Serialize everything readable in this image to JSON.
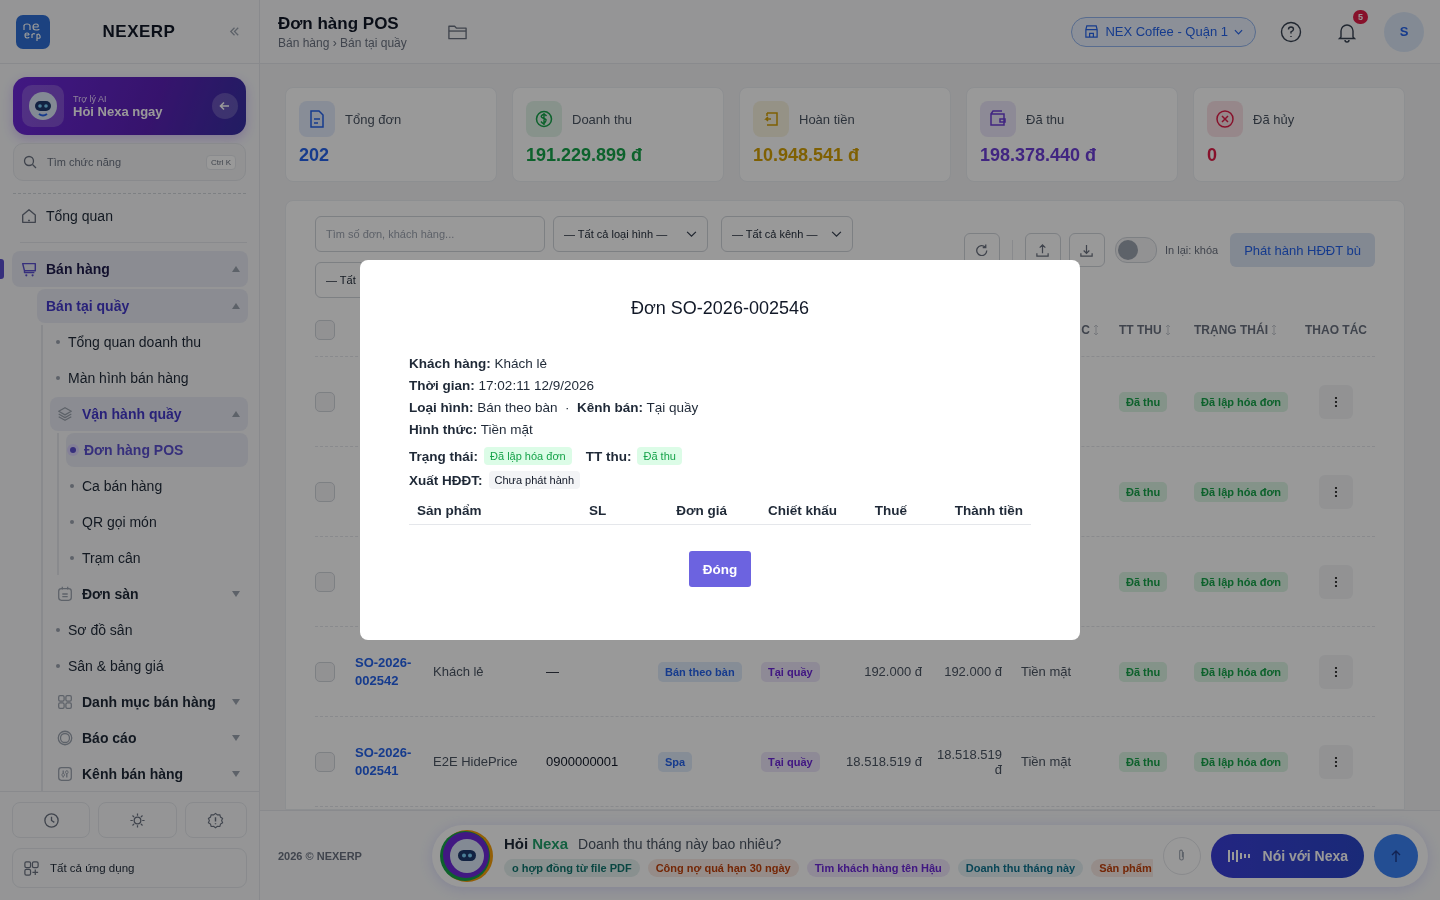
{
  "sidebar": {
    "brand": "NEXERP",
    "ai_card": {
      "caption": "Trợ lý AI",
      "title": "Hỏi Nexa ngay"
    },
    "search": {
      "placeholder": "Tìm chức năng",
      "shortcut": "Ctrl K"
    },
    "nav": [
      {
        "label": "Tổng quan",
        "kind": "link",
        "selected": false
      },
      {
        "label": "Bán hàng",
        "kind": "group",
        "expanded": true,
        "selected": true,
        "children": [
          {
            "label": "Bán tại quầy",
            "kind": "group",
            "expanded": true,
            "selected": true,
            "children": [
              {
                "label": "Tổng quan doanh thu",
                "kind": "link",
                "selected": false
              },
              {
                "label": "Màn hình bán hàng",
                "kind": "link",
                "selected": false
              },
              {
                "label": "Vận hành quầy",
                "kind": "group",
                "expanded": true,
                "selected": true,
                "children": [
                  {
                    "label": "Đơn hàng POS",
                    "kind": "link",
                    "selected": true
                  },
                  {
                    "label": "Ca bán hàng",
                    "kind": "link",
                    "selected": false
                  },
                  {
                    "label": "QR gọi món",
                    "kind": "link",
                    "selected": false
                  },
                  {
                    "label": "Trạm cân",
                    "kind": "link",
                    "selected": false
                  }
                ]
              },
              {
                "label": "Đơn sàn",
                "kind": "group",
                "expanded": false,
                "selected": false
              },
              {
                "label": "Sơ đồ sân",
                "kind": "link",
                "selected": false
              },
              {
                "label": "Sân & bảng giá",
                "kind": "link",
                "selected": false
              },
              {
                "label": "Danh mục bán hàng",
                "kind": "group",
                "expanded": false,
                "selected": false
              },
              {
                "label": "Báo cáo",
                "kind": "group",
                "expanded": false,
                "selected": false
              },
              {
                "label": "Kênh bán hàng",
                "kind": "group",
                "expanded": false,
                "selected": false
              }
            ]
          }
        ]
      }
    ],
    "all_apps": "Tất cả ứng dụng"
  },
  "header": {
    "title": "Đơn hàng POS",
    "breadcrumb": "Bán hàng › Bán tại quầy",
    "store": "NEX Coffee - Quận 1",
    "notifications": "5",
    "avatar": "S"
  },
  "stats": [
    {
      "label": "Tổng đơn",
      "value": "202"
    },
    {
      "label": "Doanh thu",
      "value": "191.229.899 đ"
    },
    {
      "label": "Hoàn tiền",
      "value": "10.948.541 đ"
    },
    {
      "label": "Đã thu",
      "value": "198.378.440 đ"
    },
    {
      "label": "Đã hủy",
      "value": "0"
    }
  ],
  "filters": {
    "search_placeholder": "Tìm số đơn, khách hàng...",
    "selects": [
      "— Tất cả loại hình —",
      "— Tất cả kênh —",
      "— Tất"
    ],
    "reprint": {
      "on": false,
      "label": "In lại: khóa"
    },
    "issue_button": "Phát hành HĐĐT bù"
  },
  "table": {
    "header_checked": false,
    "columns": [
      {
        "kind": "payment_method",
        "label": "C",
        "sortable": true
      },
      {
        "kind": "payment_status",
        "label": "TT THU",
        "sortable": true
      },
      {
        "kind": "status",
        "label": "TRẠNG THÁI",
        "sortable": true
      },
      {
        "kind": "actions",
        "label": "THAO TÁC",
        "sortable": false
      }
    ],
    "rows": [
      {
        "checked": false,
        "payment_status": "Đã thu",
        "status": "Đã lập hóa đơn"
      },
      {
        "checked": false,
        "payment_status": "Đã thu",
        "status": "Đã lập hóa đơn"
      },
      {
        "checked": false,
        "payment_status": "Đã thu",
        "status": "Đã lập hóa đơn"
      },
      {
        "checked": false,
        "id": "SO-2026-002542",
        "customer": "Khách lẻ",
        "phone": "—",
        "order_type": "Bán theo bàn",
        "channel": "Tại quầy",
        "subtotal": "192.000 đ",
        "total": "192.000 đ",
        "payment_method": "Tiền mặt",
        "payment_status": "Đã thu",
        "status": "Đã lập hóa đơn"
      },
      {
        "checked": false,
        "id": "SO-2026-002541",
        "customer": "E2E HidePrice",
        "phone": "0900000001",
        "order_type": "Spa",
        "channel": "Tại quầy",
        "subtotal": "18.518.519 đ",
        "total": "18.518.519 đ",
        "payment_method": "Tiền mặt",
        "payment_status": "Đã thu",
        "status": "Đã lập hóa đơn"
      }
    ]
  },
  "footer": {
    "copyright": "2026 © NEXERP",
    "assistant": {
      "lead": "Hỏi",
      "brand": "Nexa",
      "placeholder": "Doanh thu tháng này bao nhiêu?",
      "chips": [
        "o hợp đồng từ file PDF",
        "Công nợ quá hạn 30 ngày",
        "Tìm khách hàng tên Hậu",
        "Doanh thu tháng này",
        "Sản phẩm"
      ],
      "voice_button": "Nói với Nexa"
    }
  },
  "modal": {
    "title": "Đơn SO-2026-002546",
    "lines": [
      "**Khách hàng:** Khách lẻ",
      "**Thời gian:** 17:02:11 12/9/2026",
      "**Loại hình:** Bán theo bàn  ·  **Kênh bán:** Tại quầy",
      "**Hình thức:** Tiền mặt"
    ],
    "status_label": "Trạng thái:",
    "status": "Đã lập hóa đơn",
    "payment_label": "TT thu:",
    "payment_status": "Đã thu",
    "einvoice_label": "Xuất HĐĐT:",
    "einvoice_status": "Chưa phát hành",
    "columns": [
      "Sản phẩm",
      "SL",
      "Đơn giá",
      "Chiết khấu",
      "Thuế",
      "Thành tiền"
    ],
    "close_button": "Đóng"
  }
}
